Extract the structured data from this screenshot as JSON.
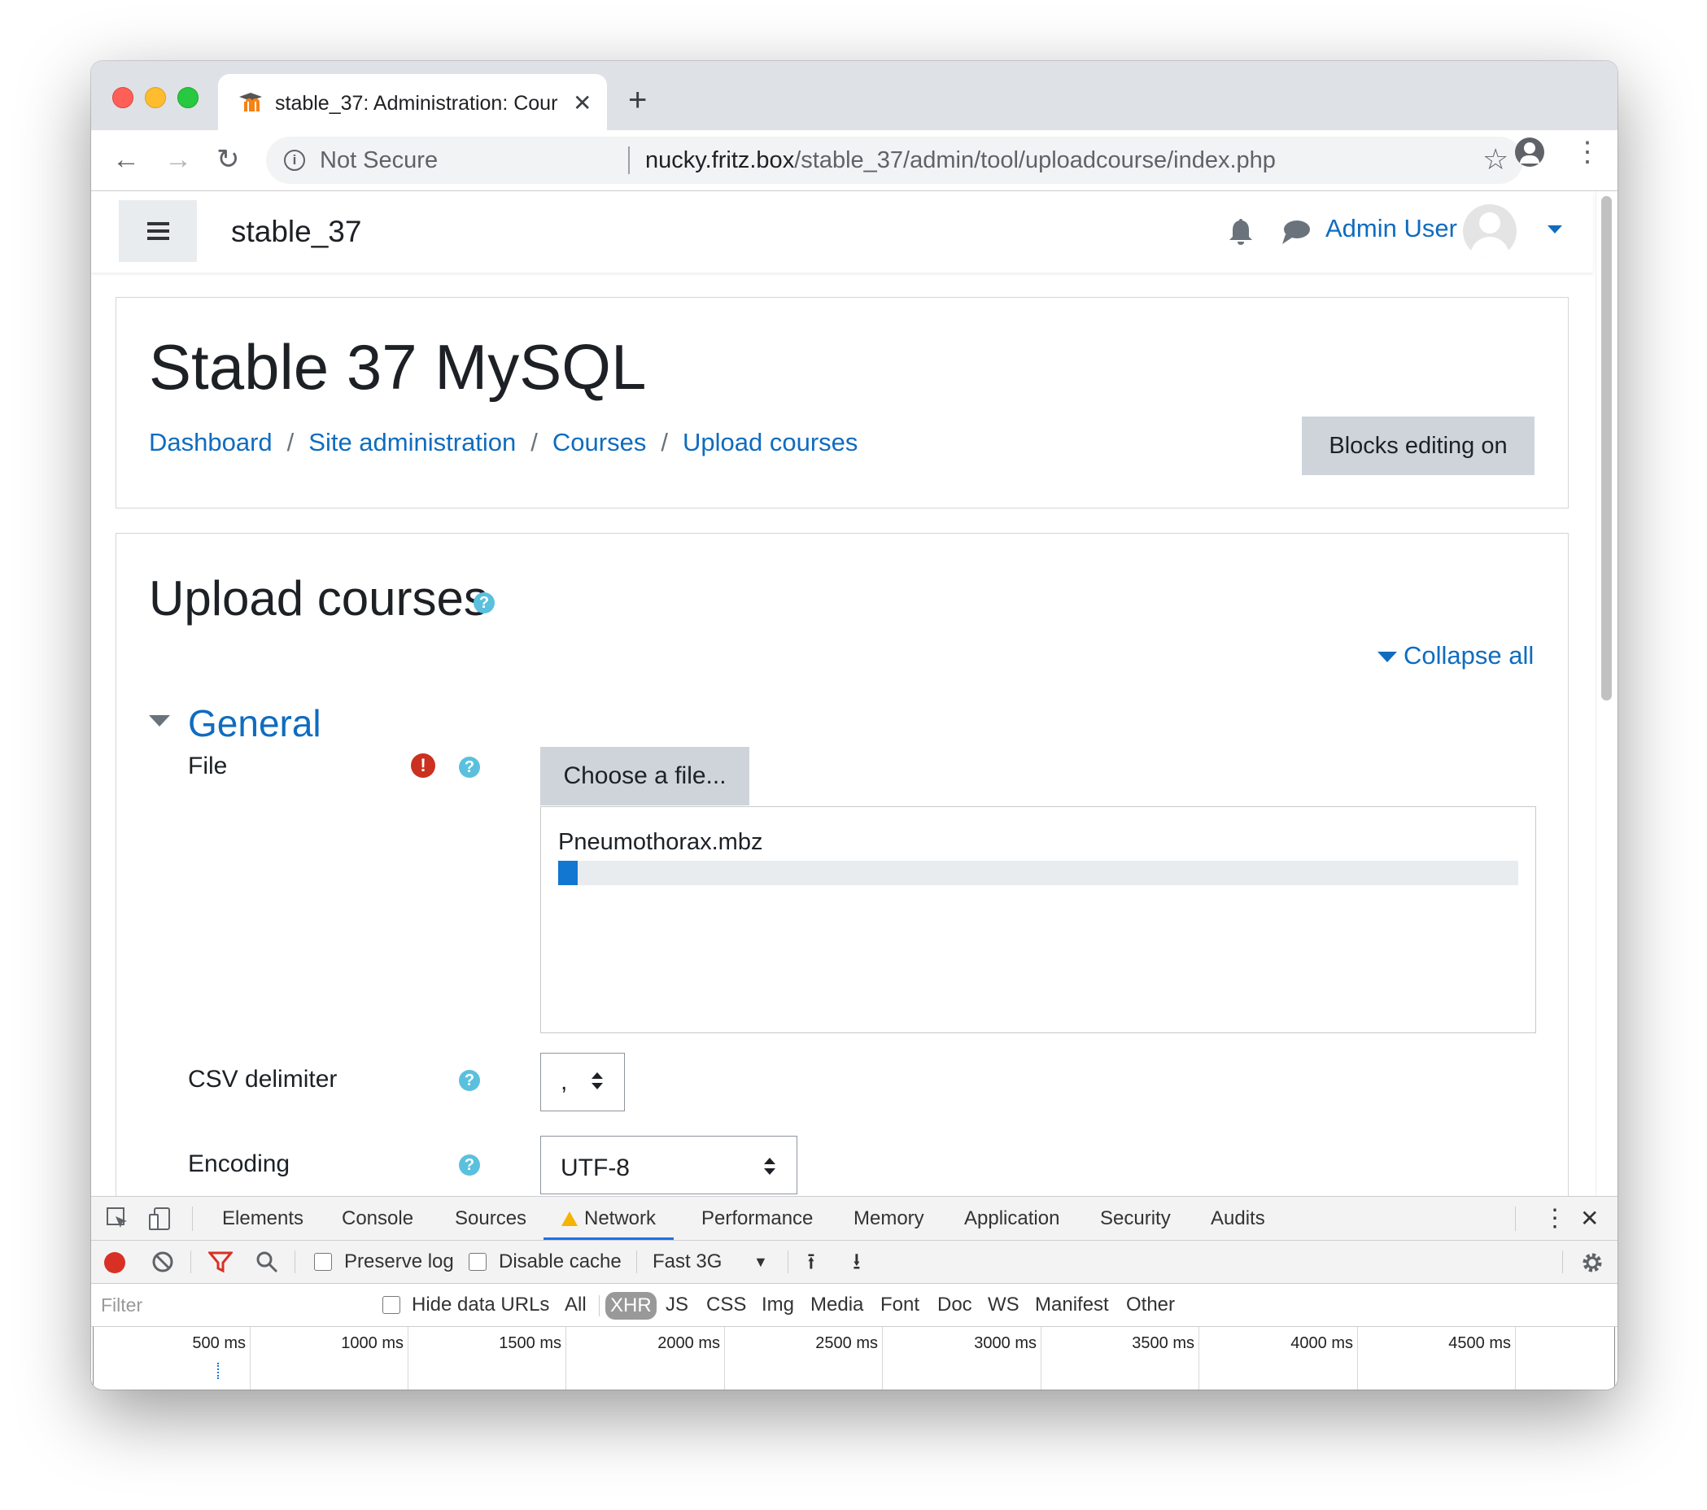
{
  "browser": {
    "tab_title": "stable_37: Administration: Cour",
    "tab_close": "✕",
    "new_tab": "+",
    "nav_back": "←",
    "nav_forward": "→",
    "nav_reload": "↻",
    "security_label": "Not Secure",
    "url_host": "nucky.fritz.box",
    "url_path": "/stable_37/admin/tool/uploadcourse/index.php",
    "bookmark_star": "☆",
    "menu_kebab": "⋮"
  },
  "navbar": {
    "menu_icon": "hamburger-menu-icon",
    "site_name": "stable_37",
    "user_name": "Admin User"
  },
  "header": {
    "title": "Stable 37 MySQL",
    "breadcrumb": [
      "Dashboard",
      "Site administration",
      "Courses",
      "Upload courses"
    ],
    "breadcrumb_sep": "/",
    "blocks_button": "Blocks editing on"
  },
  "form": {
    "heading": "Upload courses",
    "help_glyph": "?",
    "required_glyph": "!",
    "collapse_all": "Collapse all",
    "section_title": "General",
    "file_label": "File",
    "choose_file_button": "Choose a file...",
    "uploaded_filename": "Pneumothorax.mbz",
    "upload_progress": 0.02,
    "csv_delimiter_label": "CSV delimiter",
    "csv_delimiter_value": ",",
    "encoding_label": "Encoding",
    "encoding_value": "UTF-8"
  },
  "devtools": {
    "tabs": [
      "Elements",
      "Console",
      "Sources",
      "Network",
      "Performance",
      "Memory",
      "Application",
      "Security",
      "Audits"
    ],
    "active_tab": "Network",
    "close": "✕",
    "kebab": "⋮",
    "preserve_log": "Preserve log",
    "disable_cache": "Disable cache",
    "throttle": "Fast 3G",
    "throttle_caret": "▼",
    "import_icon": "⭱",
    "export_icon": "⭳",
    "filter_placeholder": "Filter",
    "hide_data_urls": "Hide data URLs",
    "type_filters": [
      "All",
      "XHR",
      "JS",
      "CSS",
      "Img",
      "Media",
      "Font",
      "Doc",
      "WS",
      "Manifest",
      "Other"
    ],
    "active_filter": "XHR",
    "timeline_ticks": [
      "500 ms",
      "1000 ms",
      "1500 ms",
      "2000 ms",
      "2500 ms",
      "3000 ms",
      "3500 ms",
      "4000 ms",
      "4500 ms"
    ]
  },
  "colors": {
    "link": "#0f6cbf",
    "progress": "#1177d1",
    "help": "#5bc0de",
    "required": "#ca3120",
    "record": "#d93025"
  }
}
